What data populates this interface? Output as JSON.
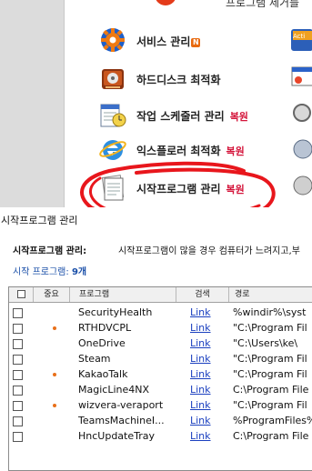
{
  "app": {
    "top_text": "프로그램 제거를",
    "menu": [
      {
        "label": "서비스 관리",
        "badge": "N",
        "restore": "",
        "icon": "gear-icon"
      },
      {
        "label": "하드디스크 최적화",
        "badge": "",
        "restore": "",
        "icon": "hard-disk-icon"
      },
      {
        "label": "작업 스케줄러 관리",
        "badge": "",
        "restore": "복원",
        "icon": "task-scheduler-icon"
      },
      {
        "label": "익스플로러 최적화",
        "badge": "",
        "restore": "복원",
        "icon": "internet-explorer-icon"
      },
      {
        "label": "시작프로그램 관리",
        "badge": "",
        "restore": "복원",
        "icon": "startup-document-icon"
      }
    ]
  },
  "dialog": {
    "title": "시작프로그램 관리",
    "info_label": "시작프로그램 관리:",
    "info_text": "시작프로그램이 많을 경우 컴퓨터가 느려지고,부",
    "count_label": "시작 프로그램:",
    "count_value": "9개",
    "columns": {
      "checkbox": "",
      "importance": "중요",
      "program": "프로그램",
      "search": "검색",
      "path": "경로"
    },
    "rows": [
      {
        "checked": false,
        "important": false,
        "program": "SecurityHealth",
        "search": "Link",
        "path": "%windir%\\syst"
      },
      {
        "checked": false,
        "important": true,
        "program": "RTHDVCPL",
        "search": "Link",
        "path": "\"C:\\Program Fil"
      },
      {
        "checked": false,
        "important": false,
        "program": "OneDrive",
        "search": "Link",
        "path": "\"C:\\Users\\ke\\"
      },
      {
        "checked": false,
        "important": false,
        "program": "Steam",
        "search": "Link",
        "path": "\"C:\\Program Fil"
      },
      {
        "checked": false,
        "important": true,
        "program": "KakaoTalk",
        "search": "Link",
        "path": "\"C:\\Program Fil"
      },
      {
        "checked": false,
        "important": false,
        "program": "MagicLine4NX",
        "search": "Link",
        "path": "C:\\Program File"
      },
      {
        "checked": false,
        "important": true,
        "program": "wizvera-veraport",
        "search": "Link",
        "path": "\"C:\\Program Fil"
      },
      {
        "checked": false,
        "important": false,
        "program": "TeamsMachineI...",
        "search": "Link",
        "path": "%ProgramFiles%"
      },
      {
        "checked": false,
        "important": false,
        "program": "HncUpdateTray",
        "search": "Link",
        "path": "C:\\Program File"
      }
    ]
  },
  "colors": {
    "accent_red": "#d4143a",
    "link_blue": "#1a3fbf",
    "count_blue": "#1a4fa8",
    "important_dot": "#e8701a"
  }
}
